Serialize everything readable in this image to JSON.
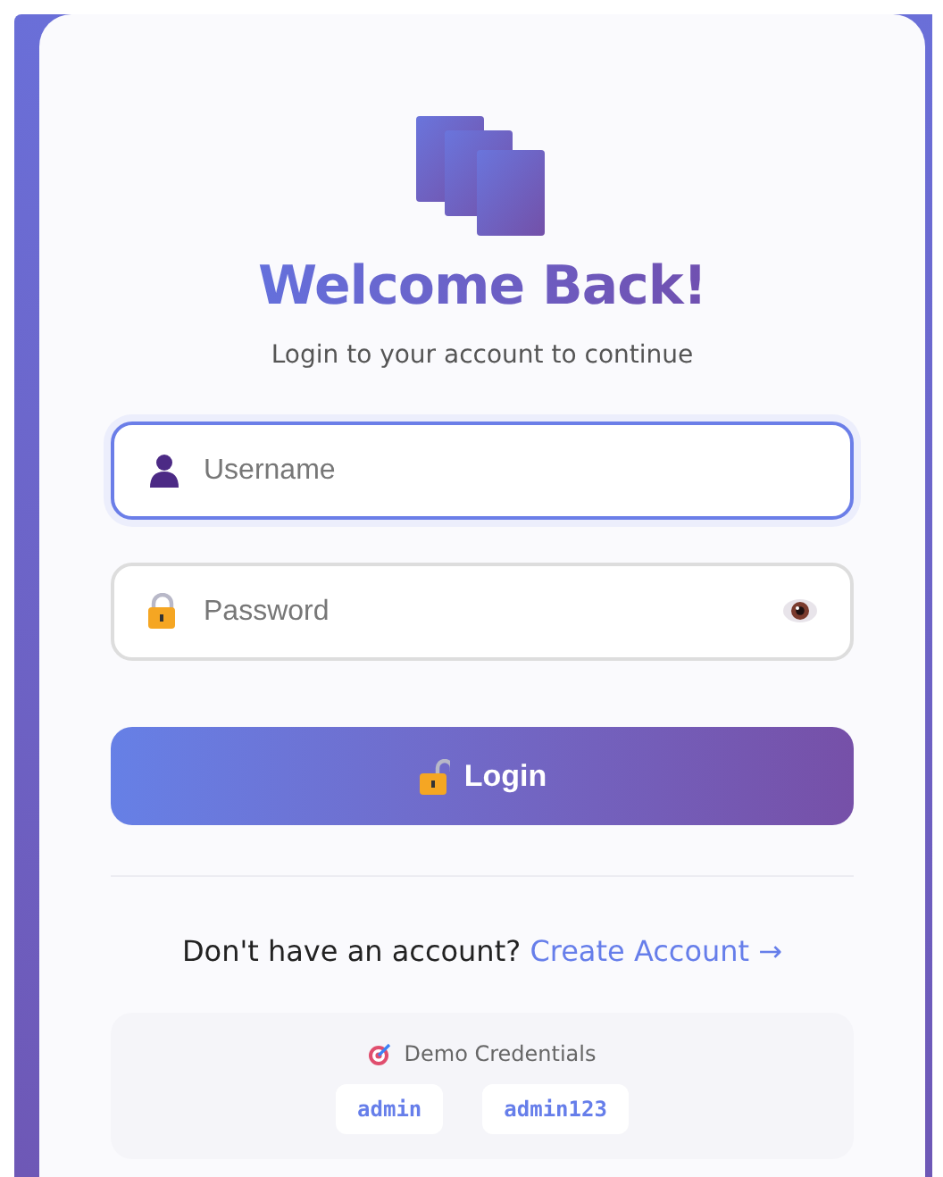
{
  "header": {
    "title": "Welcome Back!",
    "subtitle": "Login to your account to continue"
  },
  "fields": [
    {
      "kind": "text",
      "placeholder": "Username",
      "focused": true
    },
    {
      "kind": "password",
      "placeholder": "Password",
      "focused": false
    }
  ],
  "login_button": "Login",
  "signup": {
    "prompt": "Don't have an account?",
    "link": "Create Account →"
  },
  "demo": {
    "title": "Demo Credentials",
    "values": [
      "admin",
      "admin123"
    ]
  }
}
